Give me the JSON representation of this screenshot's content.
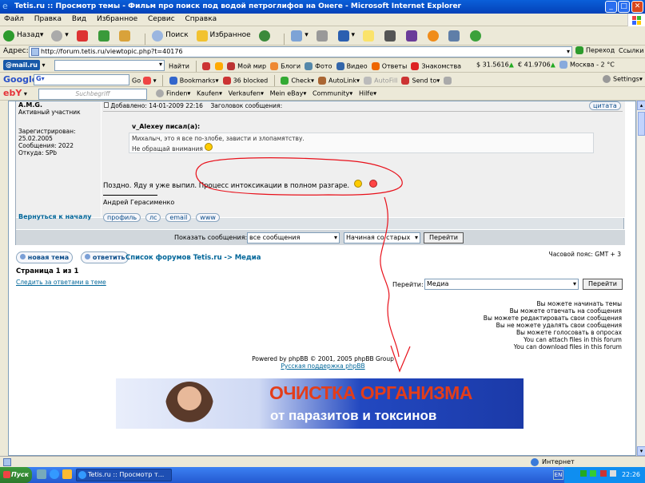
{
  "window": {
    "title": "Tetis.ru :: Просмотр темы - Фильм про поиск под водой петроглифов на Онеге - Microsoft Internet Explorer"
  },
  "menu": [
    "Файл",
    "Правка",
    "Вид",
    "Избранное",
    "Сервис",
    "Справка"
  ],
  "toolbar": {
    "back": "Назад",
    "search": "Поиск",
    "favorites": "Избранное"
  },
  "address": {
    "label": "Адрес:",
    "url": "http://forum.tetis.ru/viewtopic.php?t=40176",
    "go": "Переход",
    "links": "Ссылки"
  },
  "mailbar": {
    "logo": "@mail.ru",
    "find": "Найти",
    "items": [
      "Мой мир",
      "Блоги",
      "Фото",
      "Видео",
      "Ответы",
      "Знакомства"
    ],
    "usd": "$ 31.5616",
    "eur": "€ 41.9706",
    "weather": "Москва - 2 °C"
  },
  "googlebar": {
    "logo": "Google",
    "go": "Go",
    "bookmarks": "Bookmarks",
    "blocked": "36 blocked",
    "check": "Check",
    "autolink": "AutoLink",
    "autofill": "AutoFill",
    "sendto": "Send to",
    "settings": "Settings"
  },
  "ebaybar": {
    "logo": "ebY",
    "placeholder": "Suchbegriff",
    "items": [
      "Finden",
      "Kaufen",
      "Verkaufen",
      "Mein eBay",
      "Community",
      "Hilfe"
    ]
  },
  "post": {
    "author": "A.M.G.",
    "rank": "Активный участник",
    "registered": "Зарегистрирован: 25.02.2005",
    "messages": "Сообщения: 2022",
    "from": "Откуда: SPb",
    "posted": "Добавлено: 14-01-2009 22:16",
    "subject": "Заголовок сообщения:",
    "quote_btn": "цитата",
    "quote_author": "v_Alexey писал(а):",
    "quote_line1": "Михалыч, это я все по-злобе, зависти и злопамятству.",
    "quote_line2": "Не обращай внимания",
    "body": "Поздно. Яду я уже выпил. Процесс интоксикации в полном разгаре.",
    "signature": "Андрей Герасименко"
  },
  "back_to_top": "Вернуться к началу",
  "profile_buttons": [
    "профиль",
    "лс",
    "email",
    "www"
  ],
  "show_messages": {
    "label": "Показать сообщения:",
    "all": "все сообщения",
    "order": "Начиная со старых",
    "go": "Перейти"
  },
  "actions": {
    "new_topic": "новая тема",
    "reply": "ответить"
  },
  "breadcrumb": {
    "forums": "Список форумов Tetis.ru",
    "sep": "->",
    "section": "Медиа"
  },
  "timezone": "Часовой пояс: GMT + 3",
  "pages": "Страница 1 из 1",
  "watch": "Следить за ответами в теме",
  "jump": {
    "label": "Перейти:",
    "value": "Медиа",
    "go": "Перейти"
  },
  "permissions": [
    "Вы можете начинать темы",
    "Вы можете отвечать на сообщения",
    "Вы можете редактировать свои сообщения",
    "Вы не можете удалять свои сообщения",
    "Вы можете голосовать в опросах",
    "You can attach files in this forum",
    "You can download files in this forum"
  ],
  "footer": {
    "powered": "Powered by phpBB © 2001, 2005 phpBB Group",
    "support": "Русская поддержка phpBB"
  },
  "banner": {
    "line1": "ОЧИСТКА ОРГАНИЗМА",
    "line2": "от паразитов и токсинов"
  },
  "status": {
    "zone": "Интернет"
  },
  "taskbar": {
    "start": "Пуск",
    "task": "Tetis.ru :: Просмотр т...",
    "lang": "EN",
    "time": "22:26"
  },
  "colors": {
    "accent": "#006699",
    "annotation": "#e8101a",
    "banner_title": "#e33d1a",
    "banner_bg": "#1b3aa8"
  }
}
